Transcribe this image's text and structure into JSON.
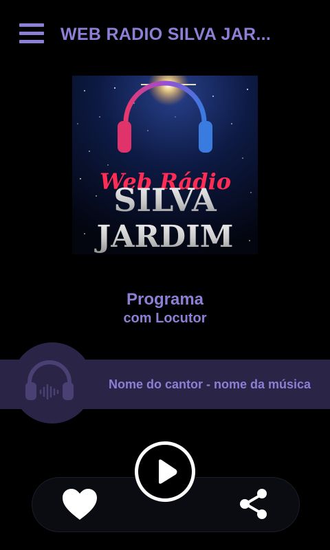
{
  "header": {
    "title": "WEB RADIO SILVA JAR...",
    "menu_icon": "hamburger-menu-icon"
  },
  "logo": {
    "line1": "Web Rádio",
    "line2": "SILVA",
    "line3": "JARDIM"
  },
  "program": {
    "name": "Programa",
    "host": "com Locutor"
  },
  "now_playing": {
    "track": "Nome do cantor - nome da música",
    "art_icon": "headphones-icon"
  },
  "controls": {
    "like_icon": "heart-icon",
    "play_icon": "play-icon",
    "share_icon": "share-icon"
  },
  "colors": {
    "accent": "#8b7fd6",
    "background": "#000000",
    "bar": "#2a2446"
  }
}
